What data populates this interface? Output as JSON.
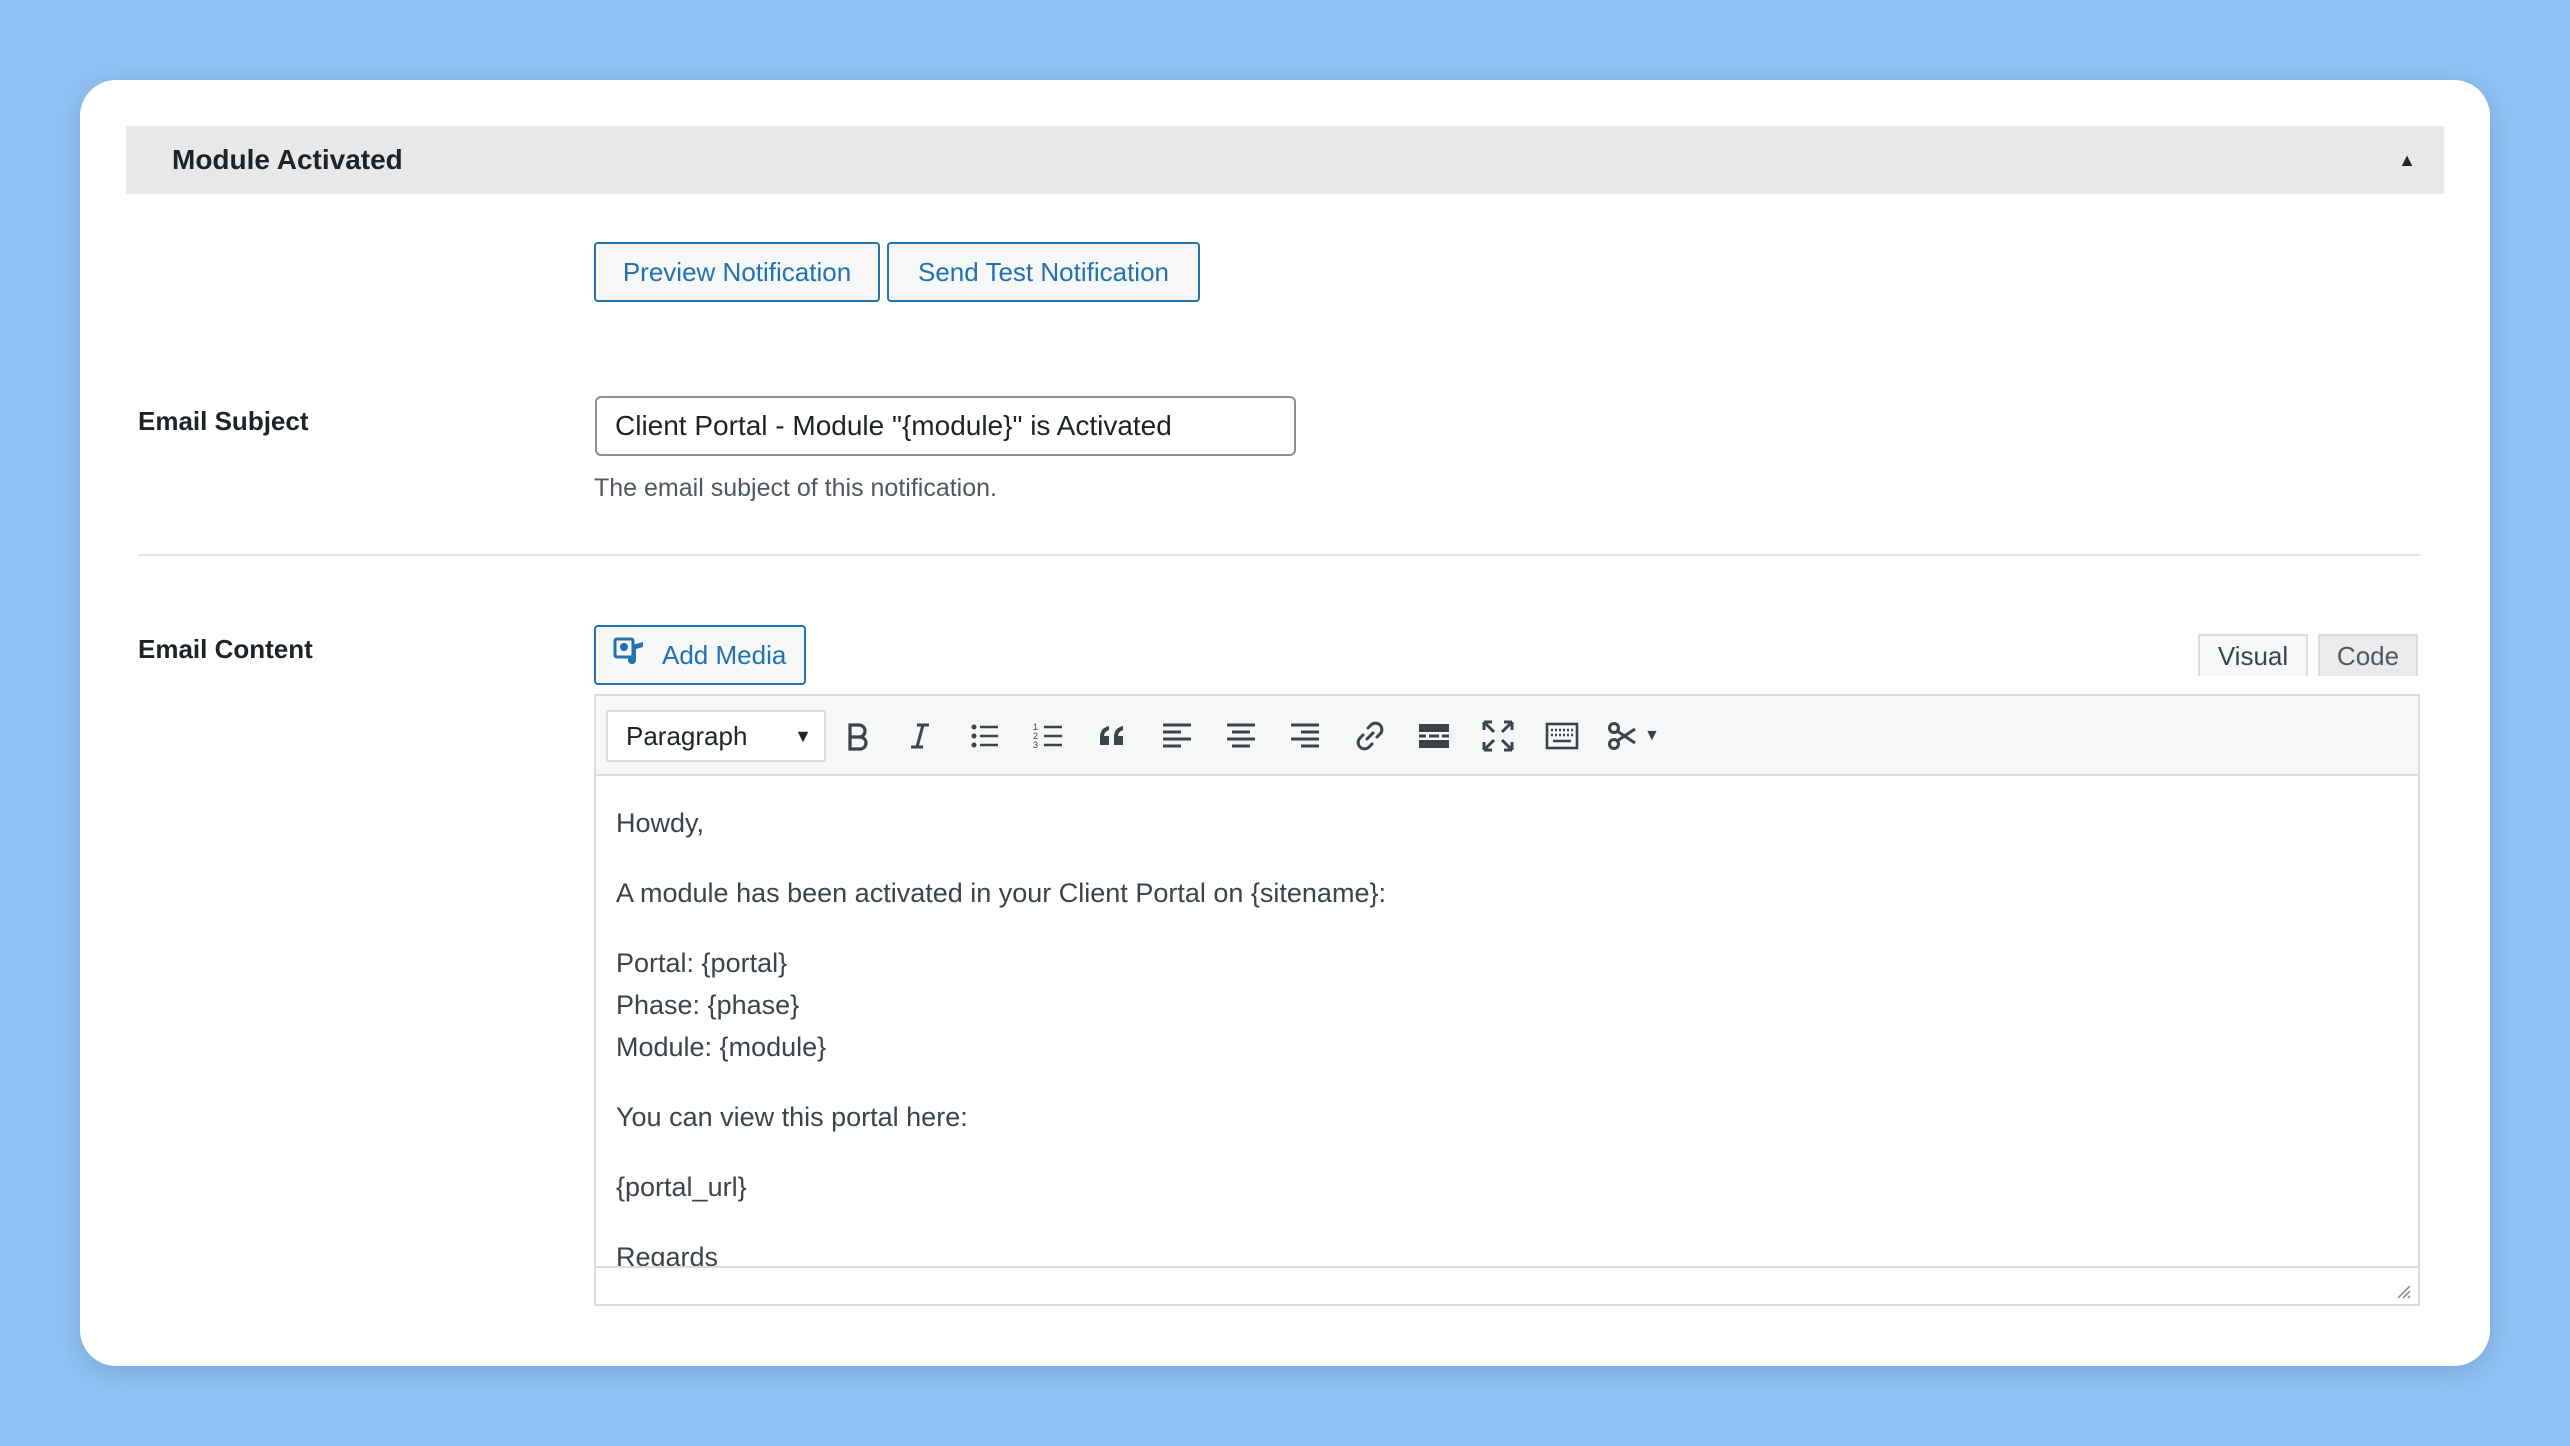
{
  "section": {
    "title": "Module Activated",
    "toggle_icon": "▲"
  },
  "buttons": {
    "preview": "Preview Notification",
    "send_test": "Send Test Notification"
  },
  "email_subject": {
    "label": "Email Subject",
    "value": "Client Portal - Module \"{module}\" is Activated",
    "description": "The email subject of this notification."
  },
  "email_content": {
    "label": "Email Content",
    "add_media": "Add Media",
    "tabs": {
      "visual": "Visual",
      "code": "Code"
    },
    "toolbar": {
      "format": "Paragraph",
      "icons": [
        "bold-icon",
        "italic-icon",
        "bullet-list-icon",
        "numbered-list-icon",
        "blockquote-icon",
        "align-left-icon",
        "align-center-icon",
        "align-right-icon",
        "link-icon",
        "read-more-icon",
        "fullscreen-icon",
        "toolbar-toggle-icon",
        "shortcode-icon"
      ]
    },
    "body": {
      "greeting": "Howdy,",
      "intro": "A module has been activated in your Client Portal on {sitename}:",
      "portal": "Portal: {portal}",
      "phase": "Phase: {phase}",
      "module": "Module: {module}",
      "view_line": "You can view this portal here:",
      "url": "{portal_url}",
      "closing": "Regards"
    }
  },
  "colors": {
    "background": "#93c3f4",
    "accent": "#2271b1",
    "header_bg": "#e8e8e8"
  }
}
